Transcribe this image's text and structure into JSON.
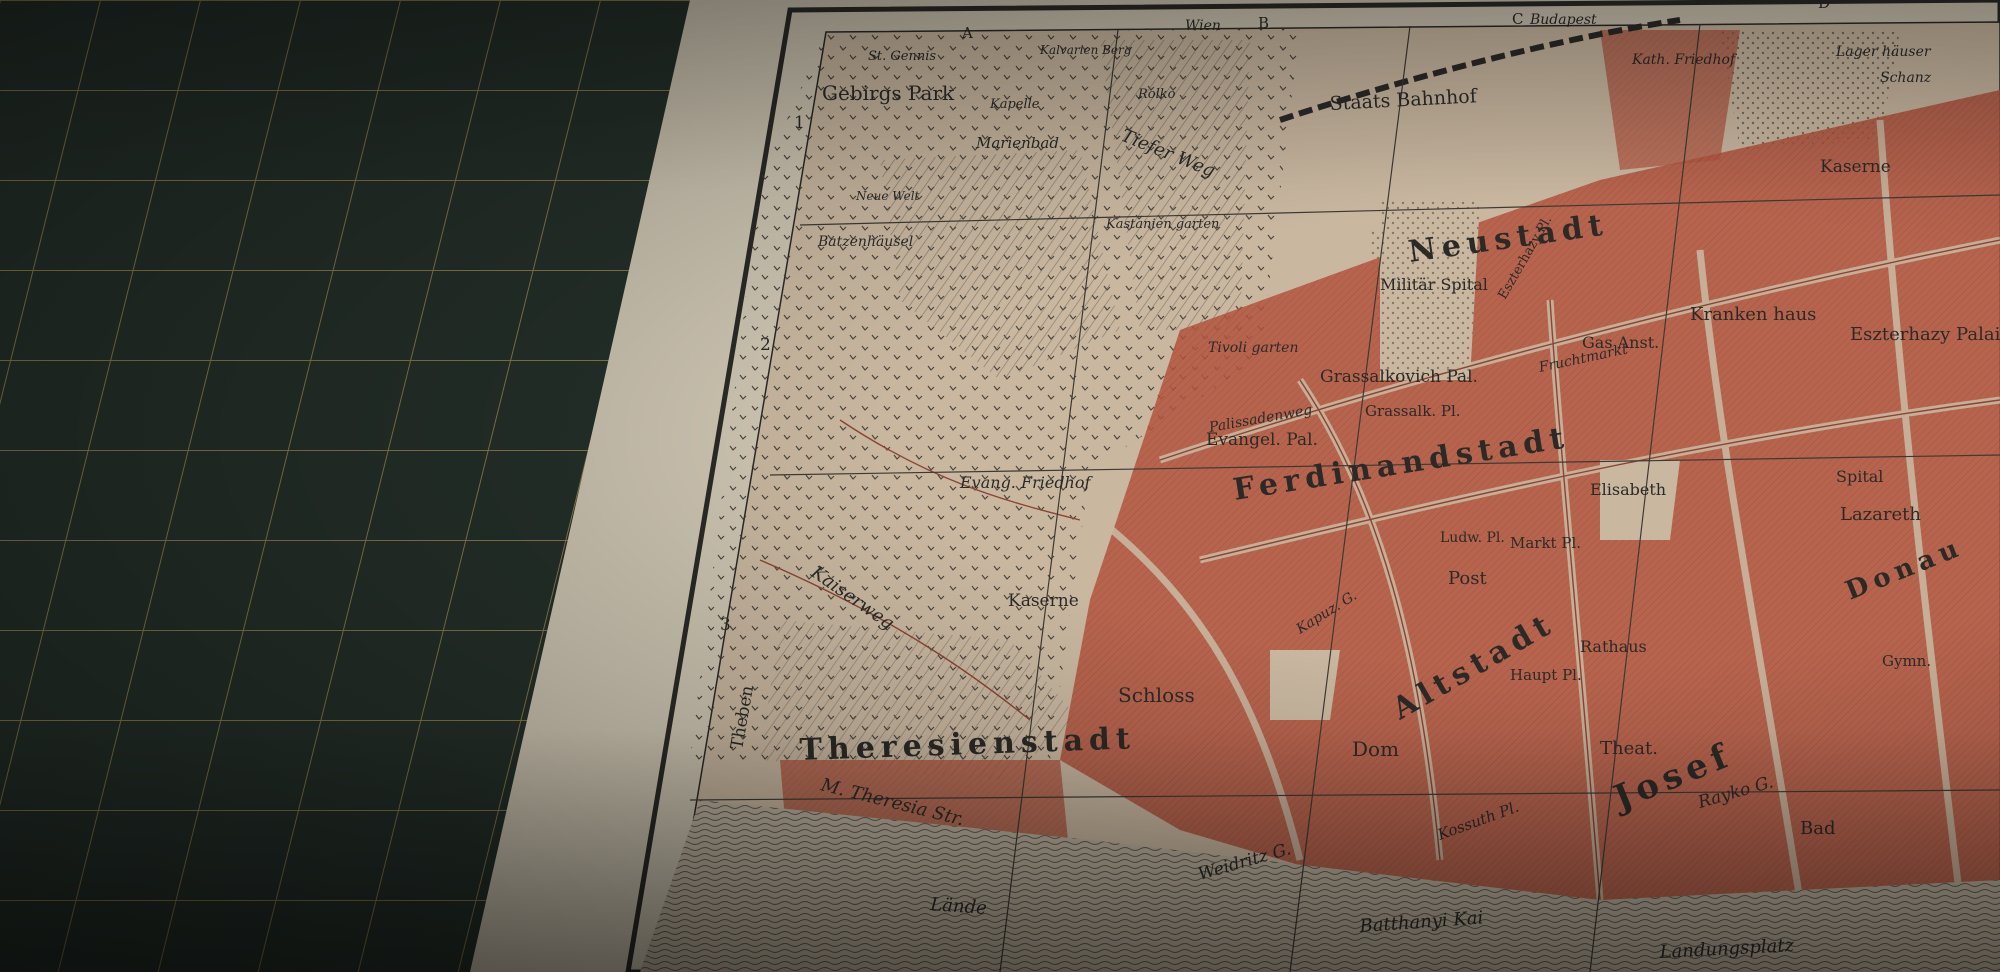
{
  "scene": {
    "colors": {
      "mat": "#25302a",
      "mat_grid": "#8a7a4a",
      "paper": "#cfc6b3",
      "map_bg": "#c9b7a0",
      "ink": "#2b2a27",
      "buildings": "#b4553f",
      "hatch": "#6a6055"
    }
  },
  "map": {
    "column_letters": [
      "A",
      "B",
      "C",
      "D"
    ],
    "row_numbers": [
      "1",
      "2",
      "3"
    ],
    "margin_labels": {
      "wien": "Wien",
      "budapest": "Budapest",
      "theben": "Theben"
    },
    "districts": {
      "neustadt": "Neustadt",
      "ferdinandstadt": "Ferdinandstadt",
      "altstadt": "Altstadt",
      "theresienstadt": "Theresienstadt",
      "josefstadt": "Josef"
    },
    "places": {
      "st_gennis": "St. Gennis",
      "kalvarien_berg": "Kalvarien Berg",
      "gebirgs_park": "Gebirgs Park",
      "kapelle": "Kapelle",
      "rolko": "Rolko",
      "marienbad": "Marienbad",
      "staats_bahnhof": "Staats Bahnhof",
      "kath_friedhof": "Kath. Friedhof",
      "lager_haeuser": "Lager häuser",
      "schanz": "Schanz",
      "neue_welt": "Neue Welt",
      "batzenhaeusel": "Batzenhäusel",
      "kastanien_garten": "Kastanien garten",
      "kaserne_n": "Kaserne",
      "militaer_spital": "Militär Spital",
      "eszterhazy_pl": "Eszterhazy Pl.",
      "kranken_haus": "Kranken haus",
      "eszterhazy_palais": "Eszterhazy Palais",
      "tivoli_garten": "Tivoli garten",
      "gas_anst": "Gas Anst.",
      "grassalkovich_pal": "Grassalkovich Pal.",
      "grassalk_pl": "Grassalk. Pl.",
      "palisadenweg": "Palissadenweg",
      "evangel_pal": "Evangel. Pal.",
      "evang_friedhof": "Evang. Friedhof",
      "elisabeth": "Elisabeth",
      "spital": "Spital",
      "lazareth": "Lazareth",
      "ludw_pl": "Ludw. Pl.",
      "markt_pl": "Markt Pl.",
      "post": "Post",
      "kaserne_s": "Kaserne",
      "rathaus": "Rathaus",
      "haupt_pl": "Haupt Pl.",
      "schloss": "Schloss",
      "dom": "Dom",
      "theat": "Theat.",
      "gymn": "Gymn.",
      "bad": "Bad",
      "landungsplatz": "Landungsplatz",
      "donau": "Donau"
    },
    "streets": {
      "kaiserweg": "Kaiserweg",
      "m_theresia_str": "M. Theresia Str.",
      "lude": "Lände",
      "weidritz_g": "Weidritz G.",
      "battanyi_kai": "Batthanyi Kai",
      "kossuth_pl": "Kossuth Pl.",
      "tiefer_weg": "Tiefer Weg",
      "fleischmarkt": "Fruchtmarkt",
      "kapuz_g": "Kapuz. G.",
      "rayko_g": "Rayko G."
    }
  }
}
